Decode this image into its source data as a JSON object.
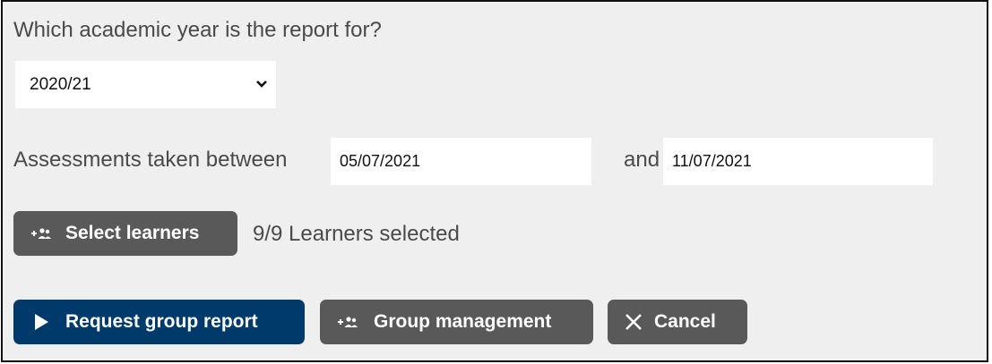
{
  "form": {
    "question": "Which academic year is the report for?",
    "year_selected": "2020/21",
    "assessments_label": "Assessments taken between",
    "start_date": "05/07/2021",
    "and_label": "and",
    "end_date": "11/07/2021",
    "select_learners_label": "Select learners",
    "learners_selected": "9/9 Learners selected"
  },
  "actions": {
    "request_label": "Request group report",
    "group_management_label": "Group management",
    "cancel_label": "Cancel"
  },
  "icons": {
    "select_learners": "add-group-icon",
    "request": "play-icon",
    "group_management": "add-group-icon",
    "cancel": "close-icon",
    "select": "chevron-down-icon"
  },
  "colors": {
    "panel_bg": "#efefef",
    "button_grey": "#595959",
    "button_blue": "#003a6b"
  }
}
